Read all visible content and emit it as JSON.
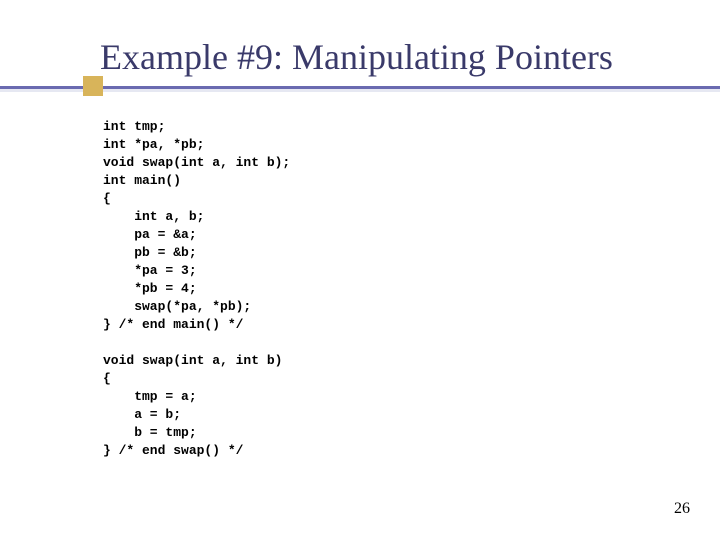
{
  "title": "Example #9: Manipulating Pointers",
  "code": "int tmp;\nint *pa, *pb;\nvoid swap(int a, int b);\nint main()\n{\n    int a, b;\n    pa = &a;\n    pb = &b;\n    *pa = 3;\n    *pb = 4;\n    swap(*pa, *pb);\n} /* end main() */\n\nvoid swap(int a, int b)\n{\n    tmp = a;\n    a = b;\n    b = tmp;\n} /* end swap() */",
  "page_number": "26"
}
